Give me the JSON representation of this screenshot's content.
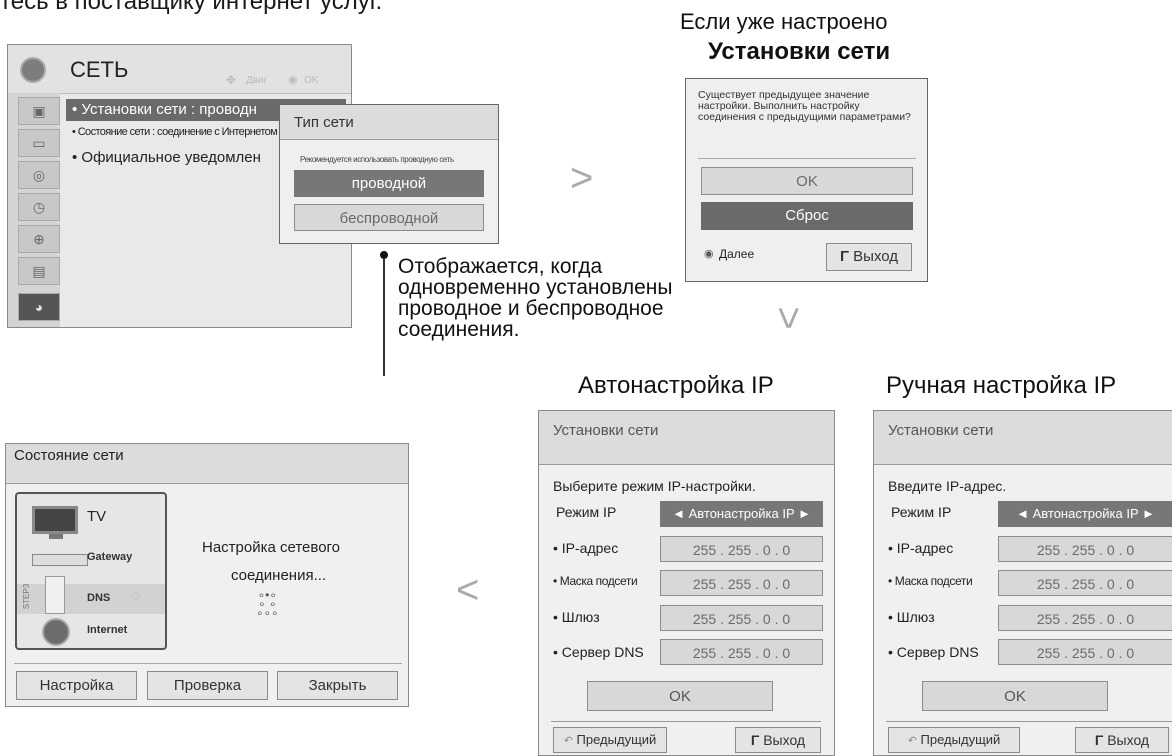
{
  "top_fragment": "тесь в поставщику интернет услуг.",
  "network_menu": {
    "title": "СЕТЬ",
    "hint_move": "Двиг",
    "hint_ok": "OK",
    "items": [
      "• Установки сети   : проводн",
      "• Состояние сети : соединение с Интернетом",
      "• Официальное уведомлен"
    ],
    "side_icons": [
      "tv-icon",
      "picture-icon",
      "audio-icon",
      "time-icon",
      "lock-icon",
      "option-icon",
      "network-icon"
    ]
  },
  "network_type": {
    "title": "Тип сети",
    "note": "Рекомендуется использовать проводную сеть",
    "wired": "проводной",
    "wireless": "беспроводной"
  },
  "callout": "Отображается, когда одновременно установлены проводное и беспроводное соединения.",
  "already_set": {
    "caption1": "Если уже настроено",
    "caption2": "Установки сети",
    "message": "Существует предыдущее значение настройки. Выполнить настройку соединения с предыдущими параметрами?",
    "ok": "OK",
    "reset": "Сброс",
    "next": "Далее",
    "exit": "Выход"
  },
  "auto_ip": {
    "caption": "Автонастройка IP",
    "header": "Установки сети",
    "prompt": "Выберите режим IP-настройки.",
    "mode_label": "Режим IP",
    "mode_value": "◄ Автонастройка IP ►",
    "rows": [
      {
        "label": "• IP-адрес",
        "value": "255 . 255 . 0 . 0"
      },
      {
        "label": "• Маска подсети",
        "value": "255 . 255 . 0 . 0"
      },
      {
        "label": "• Шлюз",
        "value": "255 . 255 . 0 . 0"
      },
      {
        "label": "• Сервер DNS",
        "value": "255 . 255 . 0 . 0"
      }
    ],
    "ok": "OK",
    "prev": "Предыдущий",
    "exit": "Выход"
  },
  "manual_ip": {
    "caption": "Ручная настройка IP",
    "header": "Установки сети",
    "prompt": "Введите IP-адрес.",
    "mode_label": "Режим IP",
    "mode_value": "◄ Автонастройка IP ►",
    "rows": [
      {
        "label": "• IP-адрес",
        "value": "255 . 255 . 0 . 0"
      },
      {
        "label": "• Маска подсети",
        "value": "255 . 255 . 0 . 0"
      },
      {
        "label": "• Шлюз",
        "value": "255 . 255 . 0 . 0"
      },
      {
        "label": "• Сервер DNS",
        "value": "255 . 255 . 0 . 0"
      }
    ],
    "ok": "OK",
    "prev": "Предыдущий",
    "exit": "Выход"
  },
  "status": {
    "header": "Состояние сети",
    "tv": "TV",
    "gateway": "Gateway",
    "dns": "DNS",
    "internet": "Internet",
    "step": "STEP3",
    "message_line1": "Настройка сетевого",
    "message_line2": "соединения...",
    "btn_setup": "Настройка",
    "btn_check": "Проверка",
    "btn_close": "Закрыть"
  }
}
